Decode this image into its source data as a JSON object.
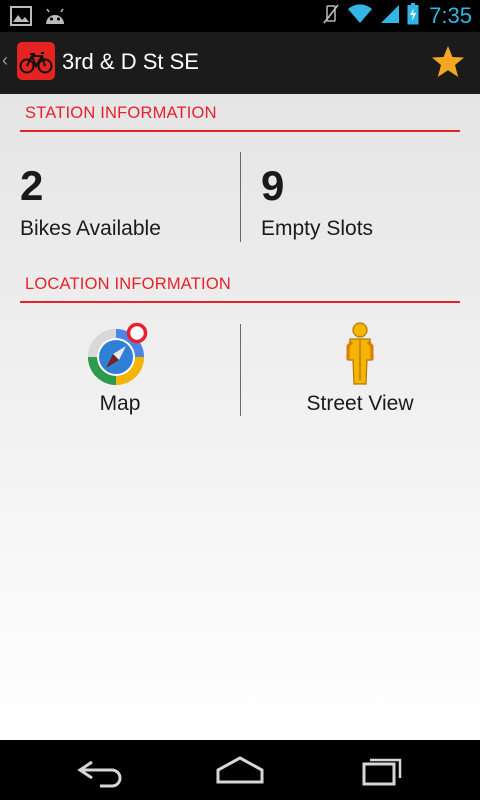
{
  "status_bar": {
    "time": "7:35",
    "icons": [
      "gallery-icon",
      "android-debug-icon",
      "vibrate-off-icon",
      "wifi-icon",
      "signal-icon",
      "battery-icon"
    ]
  },
  "action_bar": {
    "title": "3rd & D St SE",
    "icons": [
      "up-caret-icon",
      "bike-icon",
      "favorite-star-icon"
    ],
    "accent": "#e52421",
    "star_color": "#f5a623"
  },
  "station_section": {
    "header": "STATION INFORMATION",
    "bikes_available": {
      "value": "2",
      "label": "Bikes Available"
    },
    "empty_slots": {
      "value": "9",
      "label": "Empty Slots"
    }
  },
  "location_section": {
    "header": "LOCATION INFORMATION",
    "map": {
      "label": "Map",
      "icon": "maps-compass-icon"
    },
    "street_view": {
      "label": "Street View",
      "icon": "pegman-icon"
    }
  },
  "nav_bar": {
    "icons": [
      "back-icon",
      "home-icon",
      "recents-icon"
    ]
  },
  "colors": {
    "section_accent": "#e8202a",
    "clock": "#33b5e5"
  }
}
